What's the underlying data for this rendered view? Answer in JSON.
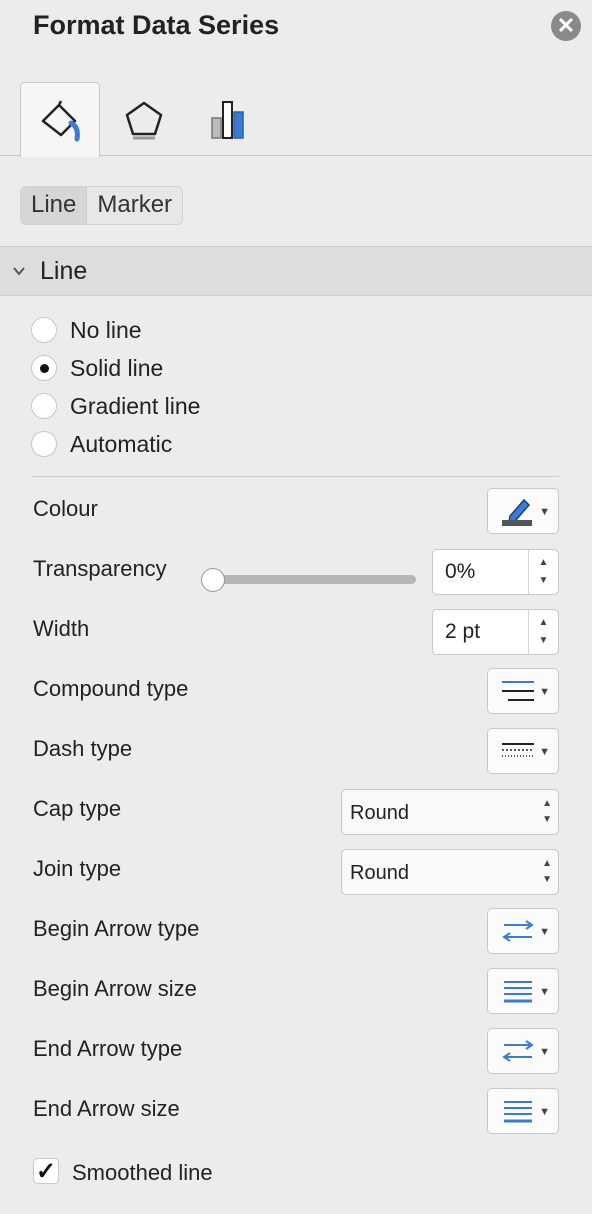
{
  "panel": {
    "title": "Format Data Series",
    "close_glyph": "✕"
  },
  "tabs": [
    {
      "icon": "fill-line-icon",
      "active": true
    },
    {
      "icon": "effects-pentagon-icon",
      "active": false
    },
    {
      "icon": "series-options-bar-icon",
      "active": false
    }
  ],
  "segments": {
    "line_label": "Line",
    "marker_label": "Marker",
    "selected": "Line"
  },
  "section": {
    "label": "Line",
    "expanded": true
  },
  "line_options": [
    {
      "label": "No line",
      "selected": false
    },
    {
      "label": "Solid line",
      "selected": true
    },
    {
      "label": "Gradient line",
      "selected": false
    },
    {
      "label": "Automatic",
      "selected": false
    }
  ],
  "properties": {
    "colour_label": "Colour",
    "transparency_label": "Transparency",
    "transparency_value": "0%",
    "transparency_level": 0,
    "width_label": "Width",
    "width_value": "2 pt",
    "compound_label": "Compound type",
    "dash_label": "Dash type",
    "cap_label": "Cap type",
    "cap_value": "Round",
    "join_label": "Join type",
    "join_value": "Round",
    "begin_arrow_type_label": "Begin Arrow type",
    "begin_arrow_size_label": "Begin Arrow size",
    "end_arrow_type_label": "End Arrow type",
    "end_arrow_size_label": "End Arrow size"
  },
  "smoothed": {
    "label": "Smoothed line",
    "checked": true,
    "check_glyph": "✓"
  },
  "colors": {
    "accent": "#3a7bd5",
    "panel_bg": "#ececec"
  }
}
